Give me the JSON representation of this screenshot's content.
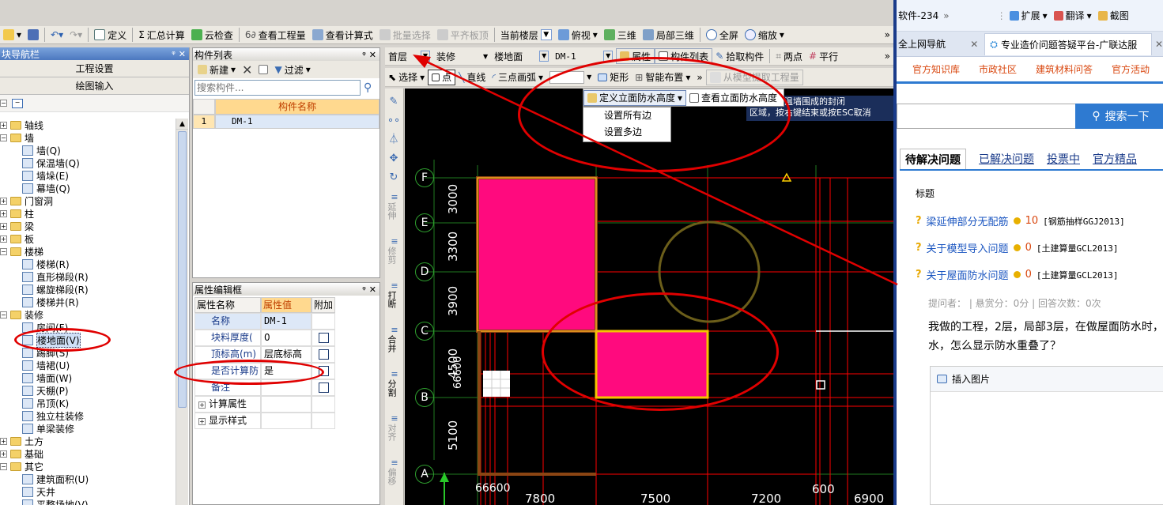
{
  "main_toolbar": {
    "define": "定义",
    "sum_calc": "汇总计算",
    "cloud_check": "云检查",
    "view_project": "查看工程量",
    "view_formula": "查看计算式",
    "batch_select": "批量选择",
    "flatten_board": "平齐板顶",
    "current_floor_label": "当前楼层",
    "top_view": "俯视",
    "three_d": "三维",
    "partial_3d": "局部三维",
    "fullscreen": "全屏",
    "zoom": "缩放"
  },
  "nav_panel": {
    "title": "块导航栏",
    "project_settings": "工程设置",
    "drawing_input": "绘图输入",
    "tree": [
      {
        "label": "轴线",
        "level": 0
      },
      {
        "label": "墙",
        "level": 0
      },
      {
        "label": "墙(Q)",
        "level": 1
      },
      {
        "label": "保温墙(Q)",
        "level": 1
      },
      {
        "label": "墙垛(E)",
        "level": 1
      },
      {
        "label": "幕墙(Q)",
        "level": 1
      },
      {
        "label": "门窗洞",
        "level": 0
      },
      {
        "label": "柱",
        "level": 0
      },
      {
        "label": "梁",
        "level": 0
      },
      {
        "label": "板",
        "level": 0
      },
      {
        "label": "楼梯",
        "level": 0
      },
      {
        "label": "楼梯(R)",
        "level": 1
      },
      {
        "label": "直形梯段(R)",
        "level": 1
      },
      {
        "label": "螺旋梯段(R)",
        "level": 1
      },
      {
        "label": "楼梯井(R)",
        "level": 1
      },
      {
        "label": "装修",
        "level": 0
      },
      {
        "label": "房间(F)",
        "level": 1
      },
      {
        "label": "楼地面(V)",
        "level": 1
      },
      {
        "label": "踢脚(S)",
        "level": 1
      },
      {
        "label": "墙裙(U)",
        "level": 1
      },
      {
        "label": "墙面(W)",
        "level": 1
      },
      {
        "label": "天棚(P)",
        "level": 1
      },
      {
        "label": "吊顶(K)",
        "level": 1
      },
      {
        "label": "独立柱装修",
        "level": 1
      },
      {
        "label": "单梁装修",
        "level": 1
      },
      {
        "label": "土方",
        "level": 0
      },
      {
        "label": "基础",
        "level": 0
      },
      {
        "label": "其它",
        "level": 0
      },
      {
        "label": "建筑面积(U)",
        "level": 1
      },
      {
        "label": "天井",
        "level": 1
      },
      {
        "label": "平整场地(V)",
        "level": 1
      }
    ]
  },
  "component_list": {
    "title": "构件列表",
    "new_btn": "新建",
    "filter_btn": "过滤",
    "search_placeholder": "搜索构件...",
    "col_name": "构件名称",
    "rows": [
      {
        "index": "1",
        "name": "DM-1"
      }
    ]
  },
  "property_panel": {
    "title": "属性编辑框",
    "col_name": "属性名称",
    "col_value": "属性值",
    "col_extra": "附加",
    "rows": [
      {
        "name": "名称",
        "value": "DM-1",
        "check": false
      },
      {
        "name": "块料厚度(",
        "value": "0",
        "check": true
      },
      {
        "name": "顶标高(m)",
        "value": "层底标高",
        "check": true
      },
      {
        "name": "是否计算防",
        "value": "是",
        "check": true
      },
      {
        "name": "备注",
        "value": "",
        "check": true
      },
      {
        "name": "计算属性",
        "value": "",
        "check": false
      },
      {
        "name": "显示样式",
        "value": "",
        "check": false
      }
    ]
  },
  "draw_toolbar": {
    "floor": "首层",
    "category": "装修",
    "type": "楼地面",
    "component": "DM-1",
    "attributes": "属性",
    "component_list": "构件列表",
    "pick": "拾取构件",
    "two_point": "两点",
    "parallel": "平行"
  },
  "draw_toolbar2": {
    "select": "选择",
    "point": "点",
    "line": "直线",
    "arc": "三点画弧",
    "rect": "矩形",
    "smart_layout": "智能布置",
    "extract": "从模型提取工程量"
  },
  "waterproof_menu": {
    "define_btn": "定义立面防水高度",
    "view_btn": "查看立面防水高度",
    "items": [
      "设置所有边",
      "设置多边"
    ]
  },
  "hint": {
    "line1": "选墙或保温墙围成的封闭",
    "line2": "区域，按右键结束或按ESC取消"
  },
  "side_tools": [
    "延伸",
    "修剪",
    "打断",
    "合并",
    "分割",
    "对齐",
    "偏移"
  ],
  "axes": {
    "rows": [
      "F",
      "E",
      "D",
      "C",
      "B",
      "A"
    ],
    "row_dims": [
      "3000",
      "3300",
      "3900",
      "4500",
      "5100"
    ],
    "col_dims": [
      "7800",
      "7500",
      "7200",
      "600",
      "6900"
    ],
    "overlap_text": "66600",
    "overlap_text_bottom": "66600"
  },
  "browser": {
    "tab_partial": "软件-234",
    "extend": "扩展",
    "translate": "翻译",
    "screenshot": "截图",
    "tab1": "全上网导航",
    "tab2": "专业造价问题答疑平台-广联达服",
    "nav": [
      "官方知识库",
      "市政社区",
      "建筑材料问答",
      "官方活动"
    ],
    "search_btn": "搜索一下",
    "tabs": [
      "待解决问题",
      "已解决问题",
      "投票中",
      "官方精品"
    ],
    "col_title": "标题",
    "questions": [
      {
        "title": "梁延伸部分无配筋",
        "score": "10",
        "tag": "[钢筋抽样GGJ2013]"
      },
      {
        "title": "关于模型导入问题",
        "score": "0",
        "tag": "[土建算量GCL2013]"
      },
      {
        "title": "关于屋面防水问题",
        "score": "0",
        "tag": "[土建算量GCL2013]"
      }
    ],
    "meta": "提问者：  |  悬赏分：0分  |  回答次数：0次",
    "question_text1": "我做的工程，2层，局部3层，在做屋面防水时，有",
    "question_text2": "水，怎么显示防水重叠了？",
    "insert_image": "插入图片"
  },
  "colors": {
    "pink_fill": "#ff0a7e",
    "brown_border": "#8b4513",
    "yellow_border": "#f5c400",
    "red_line": "#ff0000",
    "annotation_red": "#e00000"
  }
}
